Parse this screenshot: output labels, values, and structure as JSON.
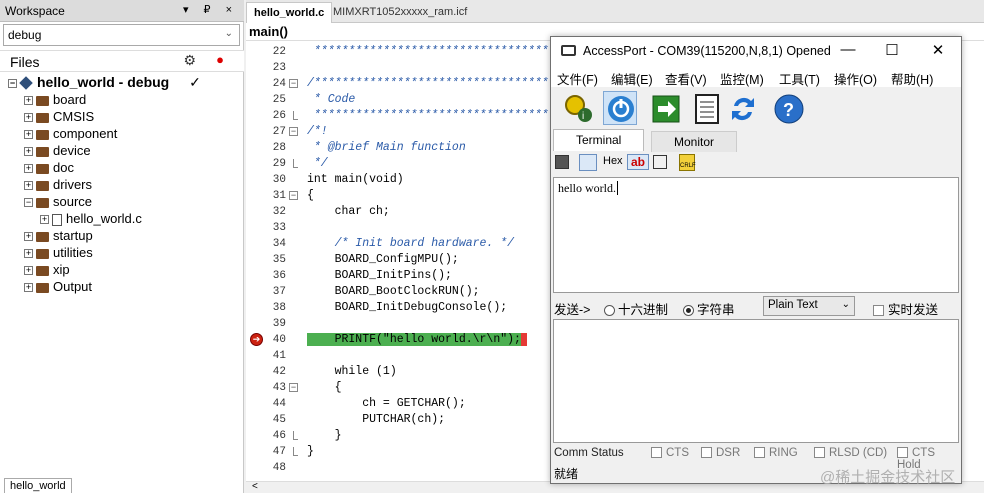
{
  "workspace": {
    "title": "Workspace",
    "controls": "▾ ₽ ×",
    "config": "debug",
    "files_label": "Files",
    "project": "hello_world - debug",
    "check": "✓",
    "tree": [
      "board",
      "CMSIS",
      "component",
      "device",
      "doc",
      "drivers",
      "source",
      "hello_world.c",
      "startup",
      "utilities",
      "xip",
      "Output"
    ],
    "bottom_tab": "hello_world"
  },
  "editor": {
    "tabs": [
      "hello_world.c",
      "MIMXRT1052xxxxx_ram.icf"
    ],
    "breadcrumb": "main()",
    "lines": [
      {
        "n": "22",
        "text": " *****************************************"
      },
      {
        "n": "23",
        "text": ""
      },
      {
        "n": "24",
        "text": "/*****************************************"
      },
      {
        "n": "25",
        "text": " * Code"
      },
      {
        "n": "26",
        "text": " *****************************************"
      },
      {
        "n": "27",
        "text": "/*!"
      },
      {
        "n": "28",
        "text": " * @brief Main function"
      },
      {
        "n": "29",
        "text": " */"
      },
      {
        "n": "30",
        "text": "int main(void)"
      },
      {
        "n": "31",
        "text": "{"
      },
      {
        "n": "32",
        "text": "    char ch;"
      },
      {
        "n": "33",
        "text": ""
      },
      {
        "n": "34",
        "text": "    /* Init board hardware. */"
      },
      {
        "n": "35",
        "text": "    BOARD_ConfigMPU();"
      },
      {
        "n": "36",
        "text": "    BOARD_InitPins();"
      },
      {
        "n": "37",
        "text": "    BOARD_BootClockRUN();"
      },
      {
        "n": "38",
        "text": "    BOARD_InitDebugConsole();"
      },
      {
        "n": "39",
        "text": ""
      },
      {
        "n": "40",
        "text": "    PRINTF(\"hello world.\\r\\n\");"
      },
      {
        "n": "41",
        "text": ""
      },
      {
        "n": "42",
        "text": "    while (1)"
      },
      {
        "n": "43",
        "text": "    {"
      },
      {
        "n": "44",
        "text": "        ch = GETCHAR();"
      },
      {
        "n": "45",
        "text": "        PUTCHAR(ch);"
      },
      {
        "n": "46",
        "text": "    }"
      },
      {
        "n": "47",
        "text": "}"
      },
      {
        "n": "48",
        "text": ""
      }
    ]
  },
  "accessport": {
    "title": "AccessPort - COM39(115200,N,8,1) Opened",
    "menu": [
      "文件(F)",
      "编辑(E)",
      "查看(V)",
      "监控(M)",
      "工具(T)",
      "操作(O)",
      "帮助(H)"
    ],
    "tabs": [
      "Terminal",
      "Monitor"
    ],
    "small_tools": [
      "Hex",
      "ab"
    ],
    "terminal_text": "hello world.",
    "send_label": "发送->",
    "radio_hex": "十六进制",
    "radio_str": "字符串",
    "format_select": "Plain Text",
    "realtime": "实时发送",
    "status_items": [
      "Comm Status",
      "CTS",
      "DSR",
      "RING",
      "RLSD (CD)",
      "CTS Hold"
    ],
    "footer": "就绪"
  },
  "watermark": "@稀土掘金技术社区"
}
